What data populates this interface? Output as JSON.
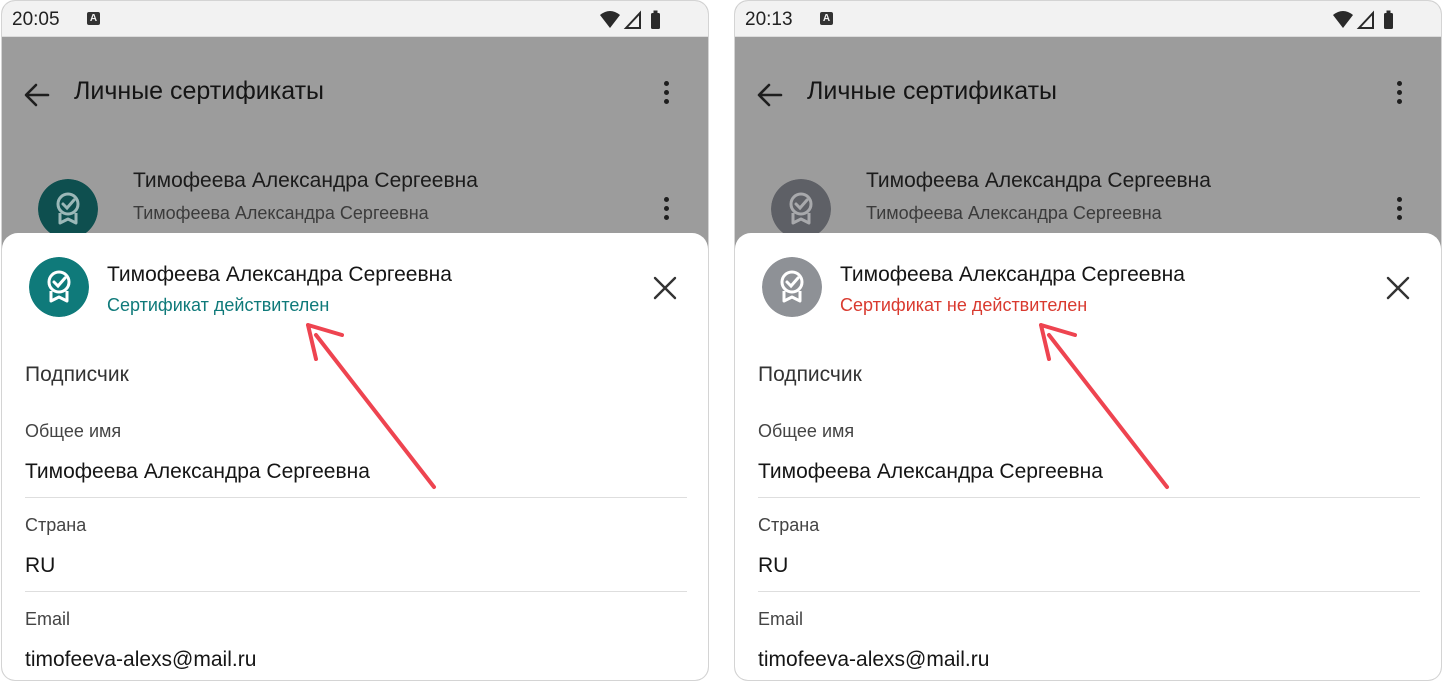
{
  "status_bar": {
    "time_left": "20:05",
    "time_right": "20:13",
    "a_icon": "A"
  },
  "appbar": {
    "title": "Личные сертификаты"
  },
  "list_item": {
    "name": "Тимофеева Александра Сергеевна",
    "subtitle": "Тимофеева Александра Сергеевна"
  },
  "sheet": {
    "name": "Тимофеева Александра Сергеевна",
    "status_valid": "Сертификат действителен",
    "status_invalid": "Сертификат не действителен",
    "section_title": "Подписчик",
    "fields": [
      {
        "label": "Общее имя",
        "value": "Тимофеева Александра Сергеевна"
      },
      {
        "label": "Страна",
        "value": "RU"
      },
      {
        "label": "Email",
        "value": "timofeeva-alexs@mail.ru"
      }
    ]
  },
  "colors": {
    "valid_teal": "#0f7a7a",
    "invalid_gray": "#8e9196",
    "invalid_text": "#d93a2f",
    "arrow_red": "#ee4450",
    "scrim": "#9c9c9c"
  },
  "icons": [
    "wifi-icon",
    "signal-icon",
    "battery-icon",
    "back-arrow-icon",
    "more-vert-icon",
    "certificate-badge-icon",
    "close-icon"
  ]
}
